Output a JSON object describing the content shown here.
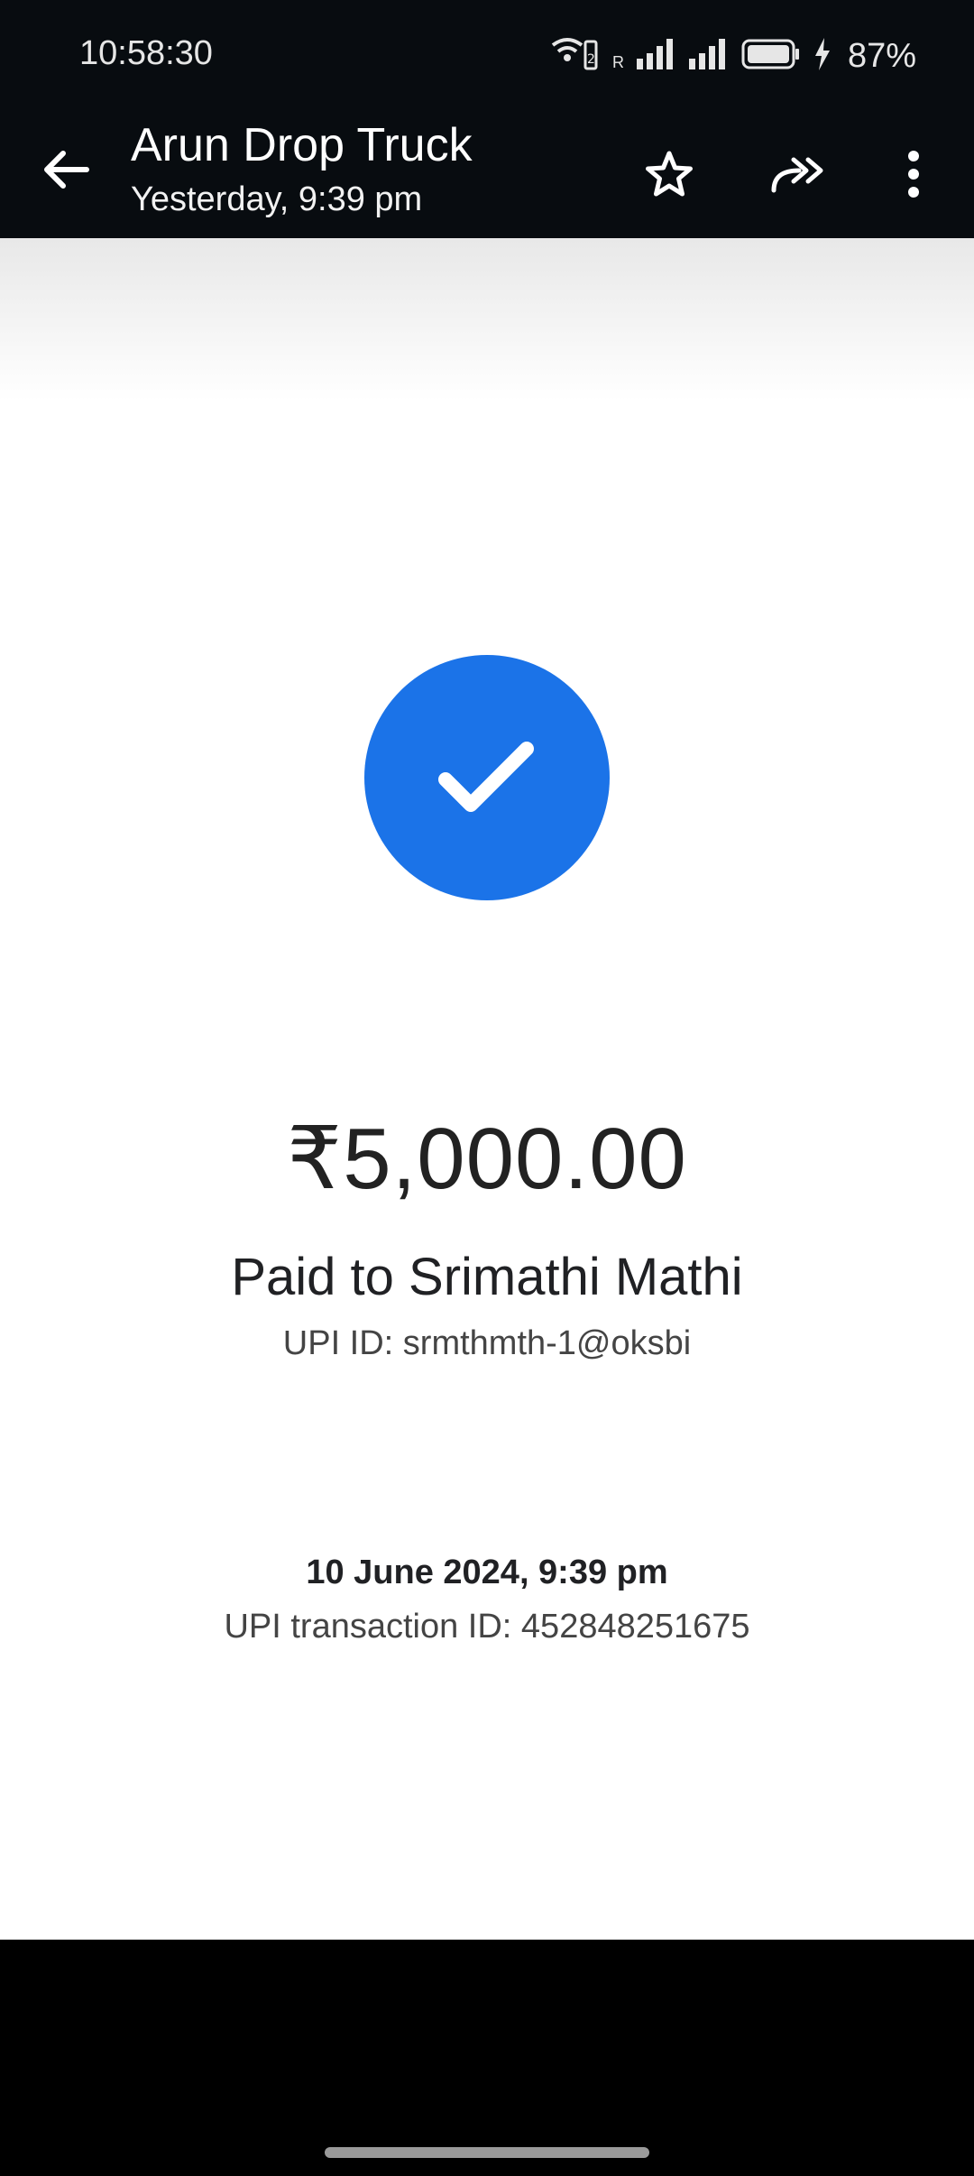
{
  "status_bar": {
    "time": "10:58:30",
    "sim_indicator": "R",
    "battery_percent": "87%",
    "icons": [
      "wifi-calling-icon",
      "signal-icon",
      "signal-icon",
      "battery-icon",
      "charging-icon"
    ]
  },
  "app_bar": {
    "title": "Arun Drop Truck",
    "subtitle": "Yesterday, 9:39 pm",
    "icons": [
      "back-arrow-icon",
      "star-icon",
      "forward-icon",
      "more-vert-icon"
    ]
  },
  "receipt": {
    "amount": "₹5,000.00",
    "paid_to": "Paid to Srimathi Mathi",
    "upi_id": "UPI ID: srmthmth-1@oksbi",
    "datetime": "10 June 2024, 9:39 pm",
    "transaction_id": "UPI transaction ID: 452848251675",
    "status_icon": "check-circle-icon",
    "accent_color": "#1b73e8"
  }
}
